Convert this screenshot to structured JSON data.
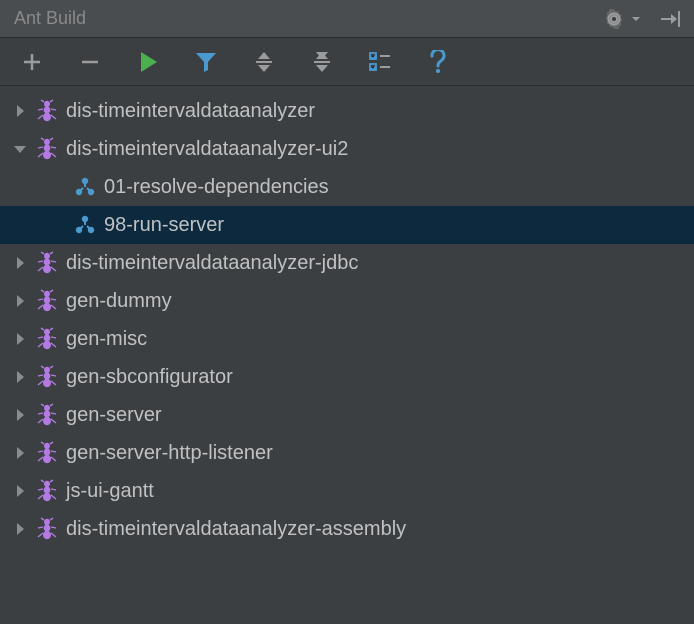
{
  "panel": {
    "title": "Ant Build"
  },
  "tree": [
    {
      "label": "dis-timeintervaldataanalyzer",
      "type": "ant",
      "expanded": false,
      "selected": false
    },
    {
      "label": "dis-timeintervaldataanalyzer-ui2",
      "type": "ant",
      "expanded": true,
      "selected": false,
      "children": [
        {
          "label": "01-resolve-dependencies",
          "type": "target",
          "selected": false
        },
        {
          "label": "98-run-server",
          "type": "target",
          "selected": true
        }
      ]
    },
    {
      "label": "dis-timeintervaldataanalyzer-jdbc",
      "type": "ant",
      "expanded": false,
      "selected": false
    },
    {
      "label": "gen-dummy",
      "type": "ant",
      "expanded": false,
      "selected": false
    },
    {
      "label": "gen-misc",
      "type": "ant",
      "expanded": false,
      "selected": false
    },
    {
      "label": "gen-sbconfigurator",
      "type": "ant",
      "expanded": false,
      "selected": false
    },
    {
      "label": "gen-server",
      "type": "ant",
      "expanded": false,
      "selected": false
    },
    {
      "label": "gen-server-http-listener",
      "type": "ant",
      "expanded": false,
      "selected": false
    },
    {
      "label": "js-ui-gantt",
      "type": "ant",
      "expanded": false,
      "selected": false
    },
    {
      "label": "dis-timeintervaldataanalyzer-assembly",
      "type": "ant",
      "expanded": false,
      "selected": false
    }
  ],
  "colors": {
    "ant_icon": "#b37ae4",
    "target_icon": "#4a9ad0",
    "run_icon": "#4caf50",
    "filter_icon": "#4a9ad0",
    "help_icon": "#4a9ad0",
    "arrow": "#8a8c8e",
    "text": "#bfc1c3"
  }
}
